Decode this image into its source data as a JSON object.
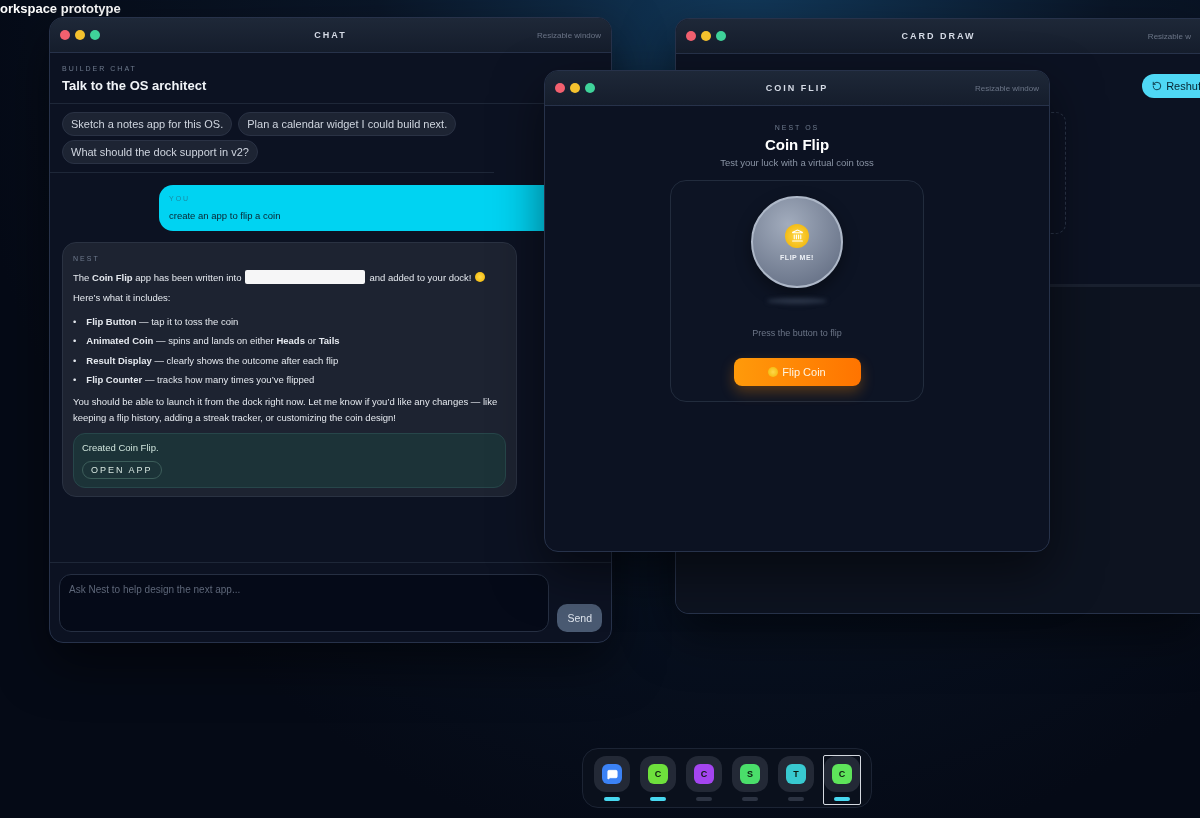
{
  "desktop": {
    "label": "orkspace prototype"
  },
  "chat_window": {
    "title": "CHAT",
    "hint": "Resizable window",
    "eyebrow": "BUILDER CHAT",
    "heading": "Talk to the OS architect",
    "suggestions": [
      "Sketch a notes app for this OS.",
      "Plan a calendar widget I could build next.",
      "What should the dock support in v2?"
    ],
    "messages": [
      {
        "kind": "user",
        "sender": "YOU",
        "text": "create an app to flip a coin"
      },
      {
        "kind": "assistant",
        "sender": "NEST",
        "intro_before": "The **Coin Flip** app has been written into",
        "intro_after": "and added to your dock!",
        "lead": "Here’s what it includes:",
        "bullets": [
          {
            "marker": "•",
            "text": "**Flip Button** — tap it to toss the coin"
          },
          {
            "marker": "•",
            "text": "**Animated Coin** — spins and lands on either **Heads** or **Tails**"
          },
          {
            "marker": "•",
            "text": "**Result Display** — clearly shows the outcome after each flip"
          },
          {
            "marker": "•",
            "text": "**Flip Counter** — tracks how many times you’ve flipped"
          }
        ],
        "closing": "You should be able to launch it from the dock right now. Let me know if you’d like any changes — like keeping a flip history, adding a streak tracker, or customizing the coin design!",
        "result": {
          "text": "Created Coin Flip.",
          "action": "OPEN APP"
        }
      }
    ],
    "composer": {
      "placeholder": "Ask Nest to help design the next app...",
      "send": "Send"
    }
  },
  "card_draw_window": {
    "title": "CARD DRAW",
    "hint": "Resizable w",
    "action": "Reshuf"
  },
  "coin_flip_window": {
    "title": "COIN FLIP",
    "hint": "Resizable window",
    "eyebrow": "NEST OS",
    "heading": "Coin Flip",
    "subtitle": "Test your luck with a virtual coin toss",
    "coin_label": "FLIP ME!",
    "status": "Press the button to flip",
    "button": "Flip Coin"
  },
  "dock": {
    "items": [
      {
        "kind": "chat",
        "color": "#3b82f6",
        "running": true,
        "selected": false
      },
      {
        "kind": "app",
        "letter": "C",
        "color": "#6ee03c",
        "running": true,
        "selected": false
      },
      {
        "kind": "app",
        "letter": "C",
        "color": "#a445f0",
        "running": false,
        "selected": false
      },
      {
        "kind": "app",
        "letter": "S",
        "color": "#4ade6a",
        "running": false,
        "selected": false
      },
      {
        "kind": "app",
        "letter": "T",
        "color": "#38c9d0",
        "running": false,
        "selected": false
      },
      {
        "kind": "app",
        "letter": "C",
        "color": "#5ee45a",
        "running": true,
        "selected": true
      }
    ]
  }
}
